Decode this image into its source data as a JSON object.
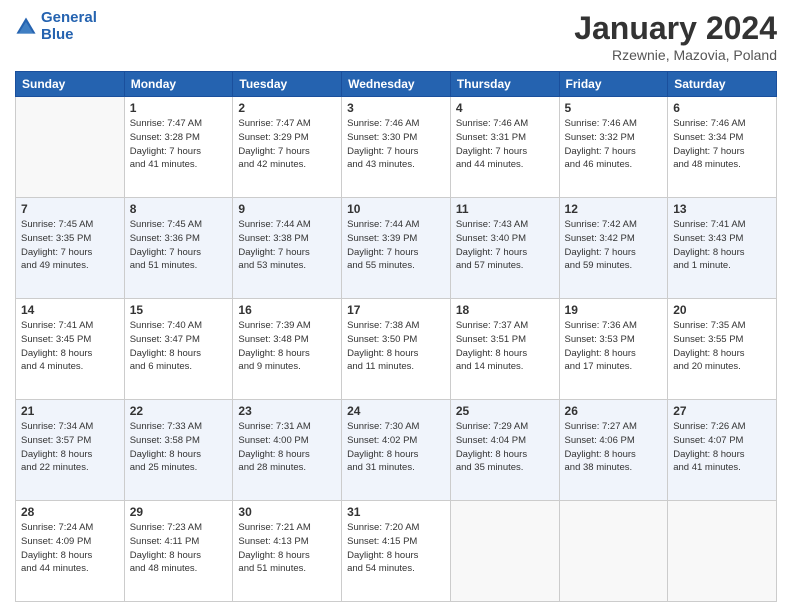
{
  "header": {
    "logo_line1": "General",
    "logo_line2": "Blue",
    "title": "January 2024",
    "location": "Rzewnie, Mazovia, Poland"
  },
  "days_of_week": [
    "Sunday",
    "Monday",
    "Tuesday",
    "Wednesday",
    "Thursday",
    "Friday",
    "Saturday"
  ],
  "weeks": [
    [
      {
        "day": "",
        "info": ""
      },
      {
        "day": "1",
        "info": "Sunrise: 7:47 AM\nSunset: 3:28 PM\nDaylight: 7 hours\nand 41 minutes."
      },
      {
        "day": "2",
        "info": "Sunrise: 7:47 AM\nSunset: 3:29 PM\nDaylight: 7 hours\nand 42 minutes."
      },
      {
        "day": "3",
        "info": "Sunrise: 7:46 AM\nSunset: 3:30 PM\nDaylight: 7 hours\nand 43 minutes."
      },
      {
        "day": "4",
        "info": "Sunrise: 7:46 AM\nSunset: 3:31 PM\nDaylight: 7 hours\nand 44 minutes."
      },
      {
        "day": "5",
        "info": "Sunrise: 7:46 AM\nSunset: 3:32 PM\nDaylight: 7 hours\nand 46 minutes."
      },
      {
        "day": "6",
        "info": "Sunrise: 7:46 AM\nSunset: 3:34 PM\nDaylight: 7 hours\nand 48 minutes."
      }
    ],
    [
      {
        "day": "7",
        "info": "Sunrise: 7:45 AM\nSunset: 3:35 PM\nDaylight: 7 hours\nand 49 minutes."
      },
      {
        "day": "8",
        "info": "Sunrise: 7:45 AM\nSunset: 3:36 PM\nDaylight: 7 hours\nand 51 minutes."
      },
      {
        "day": "9",
        "info": "Sunrise: 7:44 AM\nSunset: 3:38 PM\nDaylight: 7 hours\nand 53 minutes."
      },
      {
        "day": "10",
        "info": "Sunrise: 7:44 AM\nSunset: 3:39 PM\nDaylight: 7 hours\nand 55 minutes."
      },
      {
        "day": "11",
        "info": "Sunrise: 7:43 AM\nSunset: 3:40 PM\nDaylight: 7 hours\nand 57 minutes."
      },
      {
        "day": "12",
        "info": "Sunrise: 7:42 AM\nSunset: 3:42 PM\nDaylight: 7 hours\nand 59 minutes."
      },
      {
        "day": "13",
        "info": "Sunrise: 7:41 AM\nSunset: 3:43 PM\nDaylight: 8 hours\nand 1 minute."
      }
    ],
    [
      {
        "day": "14",
        "info": "Sunrise: 7:41 AM\nSunset: 3:45 PM\nDaylight: 8 hours\nand 4 minutes."
      },
      {
        "day": "15",
        "info": "Sunrise: 7:40 AM\nSunset: 3:47 PM\nDaylight: 8 hours\nand 6 minutes."
      },
      {
        "day": "16",
        "info": "Sunrise: 7:39 AM\nSunset: 3:48 PM\nDaylight: 8 hours\nand 9 minutes."
      },
      {
        "day": "17",
        "info": "Sunrise: 7:38 AM\nSunset: 3:50 PM\nDaylight: 8 hours\nand 11 minutes."
      },
      {
        "day": "18",
        "info": "Sunrise: 7:37 AM\nSunset: 3:51 PM\nDaylight: 8 hours\nand 14 minutes."
      },
      {
        "day": "19",
        "info": "Sunrise: 7:36 AM\nSunset: 3:53 PM\nDaylight: 8 hours\nand 17 minutes."
      },
      {
        "day": "20",
        "info": "Sunrise: 7:35 AM\nSunset: 3:55 PM\nDaylight: 8 hours\nand 20 minutes."
      }
    ],
    [
      {
        "day": "21",
        "info": "Sunrise: 7:34 AM\nSunset: 3:57 PM\nDaylight: 8 hours\nand 22 minutes."
      },
      {
        "day": "22",
        "info": "Sunrise: 7:33 AM\nSunset: 3:58 PM\nDaylight: 8 hours\nand 25 minutes."
      },
      {
        "day": "23",
        "info": "Sunrise: 7:31 AM\nSunset: 4:00 PM\nDaylight: 8 hours\nand 28 minutes."
      },
      {
        "day": "24",
        "info": "Sunrise: 7:30 AM\nSunset: 4:02 PM\nDaylight: 8 hours\nand 31 minutes."
      },
      {
        "day": "25",
        "info": "Sunrise: 7:29 AM\nSunset: 4:04 PM\nDaylight: 8 hours\nand 35 minutes."
      },
      {
        "day": "26",
        "info": "Sunrise: 7:27 AM\nSunset: 4:06 PM\nDaylight: 8 hours\nand 38 minutes."
      },
      {
        "day": "27",
        "info": "Sunrise: 7:26 AM\nSunset: 4:07 PM\nDaylight: 8 hours\nand 41 minutes."
      }
    ],
    [
      {
        "day": "28",
        "info": "Sunrise: 7:24 AM\nSunset: 4:09 PM\nDaylight: 8 hours\nand 44 minutes."
      },
      {
        "day": "29",
        "info": "Sunrise: 7:23 AM\nSunset: 4:11 PM\nDaylight: 8 hours\nand 48 minutes."
      },
      {
        "day": "30",
        "info": "Sunrise: 7:21 AM\nSunset: 4:13 PM\nDaylight: 8 hours\nand 51 minutes."
      },
      {
        "day": "31",
        "info": "Sunrise: 7:20 AM\nSunset: 4:15 PM\nDaylight: 8 hours\nand 54 minutes."
      },
      {
        "day": "",
        "info": ""
      },
      {
        "day": "",
        "info": ""
      },
      {
        "day": "",
        "info": ""
      }
    ]
  ]
}
